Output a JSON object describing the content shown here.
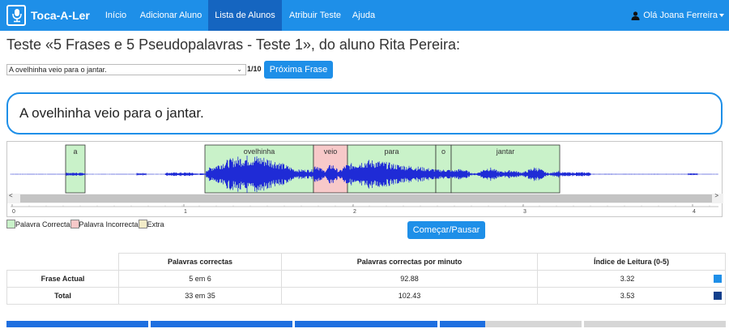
{
  "app": {
    "name": "Toca-A-Ler"
  },
  "nav": {
    "items": [
      {
        "label": "Início"
      },
      {
        "label": "Adicionar Aluno"
      },
      {
        "label": "Lista de Alunos"
      },
      {
        "label": "Atribuir Teste"
      },
      {
        "label": "Ajuda"
      }
    ],
    "user_label": "Olá Joana Ferreira"
  },
  "page": {
    "title": "Teste «5 Frases e 5 Pseudopalavras - Teste 1», do aluno Rita Pereira:"
  },
  "controls": {
    "selected_sentence": "A ovelhinha veio para o jantar.",
    "counter": "1/10",
    "next_button": "Próxima Frase",
    "play_button": "Começar/Pausar"
  },
  "sentence": {
    "text": "A ovelhinha veio para o jantar."
  },
  "waveform": {
    "words": [
      {
        "text": "a",
        "status": "correct"
      },
      {
        "text": "ovelhinha",
        "status": "correct"
      },
      {
        "text": "veio",
        "status": "incorrect"
      },
      {
        "text": "para",
        "status": "correct"
      },
      {
        "text": "o",
        "status": "correct"
      },
      {
        "text": "jantar",
        "status": "correct"
      }
    ],
    "time_ticks": [
      "0",
      "1",
      "2",
      "3",
      "4"
    ],
    "colors": {
      "correct": "#c9f2c9",
      "incorrect": "#f7c9c9",
      "extra": "#f3ecc8",
      "wave": "#1f2bd6"
    }
  },
  "legend": {
    "correct": "Palavra Correcta",
    "incorrect": "Palavra Incorrecta",
    "extra": "Extra"
  },
  "stats": {
    "headers": [
      "Palavras correctas",
      "Palavras correctas por minuto",
      "Índice de Leitura (0-5)"
    ],
    "rows": [
      {
        "label": "Frase Actual",
        "correct": "5 em 6",
        "wpm": "92.88",
        "index": "3.32",
        "color": "#1e8fe8"
      },
      {
        "label": "Total",
        "correct": "33 em 35",
        "wpm": "102.43",
        "index": "3.53",
        "color": "#123f8c"
      }
    ]
  },
  "progress": {
    "completed_sentences": 3,
    "total_sentences": 5,
    "current_fraction": 0.32,
    "accent": "#1e6fe0"
  }
}
